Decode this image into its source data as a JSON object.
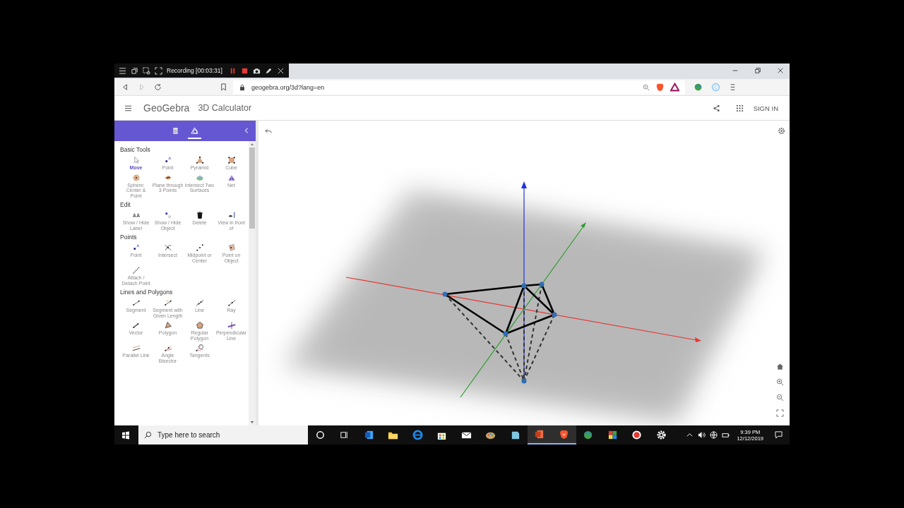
{
  "recorder_toolbar": {
    "status": "Recording [00:03:31]"
  },
  "browser": {
    "url": "geogebra.org/3d?lang=en"
  },
  "app_header": {
    "logo": "GeoGebra",
    "title": "3D Calculator",
    "sign_in": "SIGN IN"
  },
  "tool_panel": {
    "tabs": [
      {
        "kind": "algebra",
        "selected": false
      },
      {
        "kind": "tools",
        "selected": true
      }
    ],
    "sections": [
      {
        "title": "Basic Tools",
        "tools": [
          {
            "label": "Move",
            "kind": "move",
            "selected": true
          },
          {
            "label": "Point",
            "kind": "point",
            "selected": false
          },
          {
            "label": "Pyramid",
            "kind": "pyramid",
            "selected": false
          },
          {
            "label": "Cube",
            "kind": "cube",
            "selected": false
          },
          {
            "label": "Sphere: Center & Point",
            "kind": "sphere",
            "selected": false
          },
          {
            "label": "Plane through 3 Points",
            "kind": "plane",
            "selected": false
          },
          {
            "label": "Intersect Two Surfaces",
            "kind": "surfaces",
            "selected": false
          },
          {
            "label": "Net",
            "kind": "net",
            "selected": false
          }
        ]
      },
      {
        "title": "Edit",
        "tools": [
          {
            "label": "Show / Hide Label",
            "kind": "label",
            "selected": false
          },
          {
            "label": "Show / Hide Object",
            "kind": "show_object",
            "selected": false
          },
          {
            "label": "Delete",
            "kind": "delete",
            "selected": false
          },
          {
            "label": "View in front of",
            "kind": "view_front",
            "selected": false
          }
        ]
      },
      {
        "title": "Points",
        "tools": [
          {
            "label": "Point",
            "kind": "point",
            "selected": false
          },
          {
            "label": "Intersect",
            "kind": "intersect",
            "selected": false
          },
          {
            "label": "Midpoint or Center",
            "kind": "midpoint",
            "selected": false
          },
          {
            "label": "Point on Object",
            "kind": "point_on_object",
            "selected": false
          },
          {
            "label": "Attach / Detach Point",
            "kind": "attach",
            "selected": false
          }
        ]
      },
      {
        "title": "Lines and Polygons",
        "tools": [
          {
            "label": "Segment",
            "kind": "segment",
            "selected": false
          },
          {
            "label": "Segment with Given Length",
            "kind": "segment_length",
            "selected": false
          },
          {
            "label": "Line",
            "kind": "line",
            "selected": false
          },
          {
            "label": "Ray",
            "kind": "ray",
            "selected": false
          },
          {
            "label": "Vector",
            "kind": "vector",
            "selected": false
          },
          {
            "label": "Polygon",
            "kind": "polygon",
            "selected": false
          },
          {
            "label": "Regular Polygon",
            "kind": "regular_polygon",
            "selected": false
          },
          {
            "label": "Perpendicular Line",
            "kind": "perpendicular",
            "selected": false
          },
          {
            "label": "Parallel Line",
            "kind": "parallel",
            "selected": false
          },
          {
            "label": "Angle Bisector",
            "kind": "bisector",
            "selected": false
          },
          {
            "label": "Tangents",
            "kind": "tangents",
            "selected": false
          }
        ]
      }
    ]
  },
  "taskbar": {
    "search_placeholder": "Type here to search",
    "apps": [
      {
        "kind": "cortana",
        "active": false
      },
      {
        "kind": "task_view",
        "active": false
      },
      {
        "kind": "word",
        "active": false
      },
      {
        "kind": "explorer",
        "active": false
      },
      {
        "kind": "edge",
        "active": false
      },
      {
        "kind": "store",
        "active": false
      },
      {
        "kind": "mail",
        "active": false
      },
      {
        "kind": "paint",
        "active": false
      },
      {
        "kind": "notes",
        "active": false
      },
      {
        "kind": "powerpoint",
        "active": true
      },
      {
        "kind": "brave",
        "active": true
      },
      {
        "kind": "globe",
        "active": false
      },
      {
        "kind": "tiles",
        "active": false
      },
      {
        "kind": "recorder",
        "active": false
      },
      {
        "kind": "settings",
        "active": false
      }
    ],
    "time": "9:39 PM",
    "date": "12/12/2019"
  }
}
